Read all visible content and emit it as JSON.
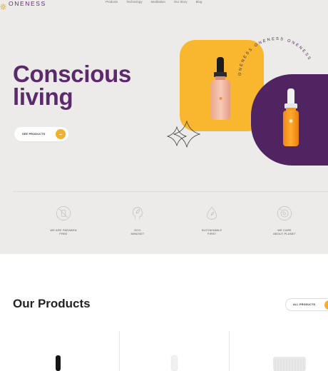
{
  "brand": {
    "name": "ONENESS",
    "accent": "#f2b12c",
    "purple": "#5a2a6b"
  },
  "nav": {
    "items": [
      "Products",
      "Technology",
      "Meditation",
      "Our Story",
      "Blog"
    ]
  },
  "hero": {
    "title_line1": "Conscious",
    "title_line2": "living",
    "cta_label": "SEE PRODUCTS",
    "circle_text": "ONENESS ONENESS ONENESS",
    "colors": {
      "background": "#ecebea",
      "yellow": "#f8b72e",
      "purple": "#4f2460"
    }
  },
  "features": [
    {
      "icon": "no-paraben-icon",
      "label": "WE ARE PARABEN\nFREE"
    },
    {
      "icon": "leaf-head-icon",
      "label": "ECO\nMINDSET"
    },
    {
      "icon": "water-drop-icon",
      "label": "SUSTAINABLE\nFIRST"
    },
    {
      "icon": "planet-icon",
      "label": "WE CARE\nABOUT PLANET"
    }
  ],
  "products": {
    "title": "Our Products",
    "all_label": "ALL PRODUCTS",
    "items": [
      {
        "icon": "dropper-bottle-dark-icon"
      },
      {
        "icon": "dropper-bottle-white-icon"
      },
      {
        "icon": "jar-icon"
      }
    ]
  }
}
